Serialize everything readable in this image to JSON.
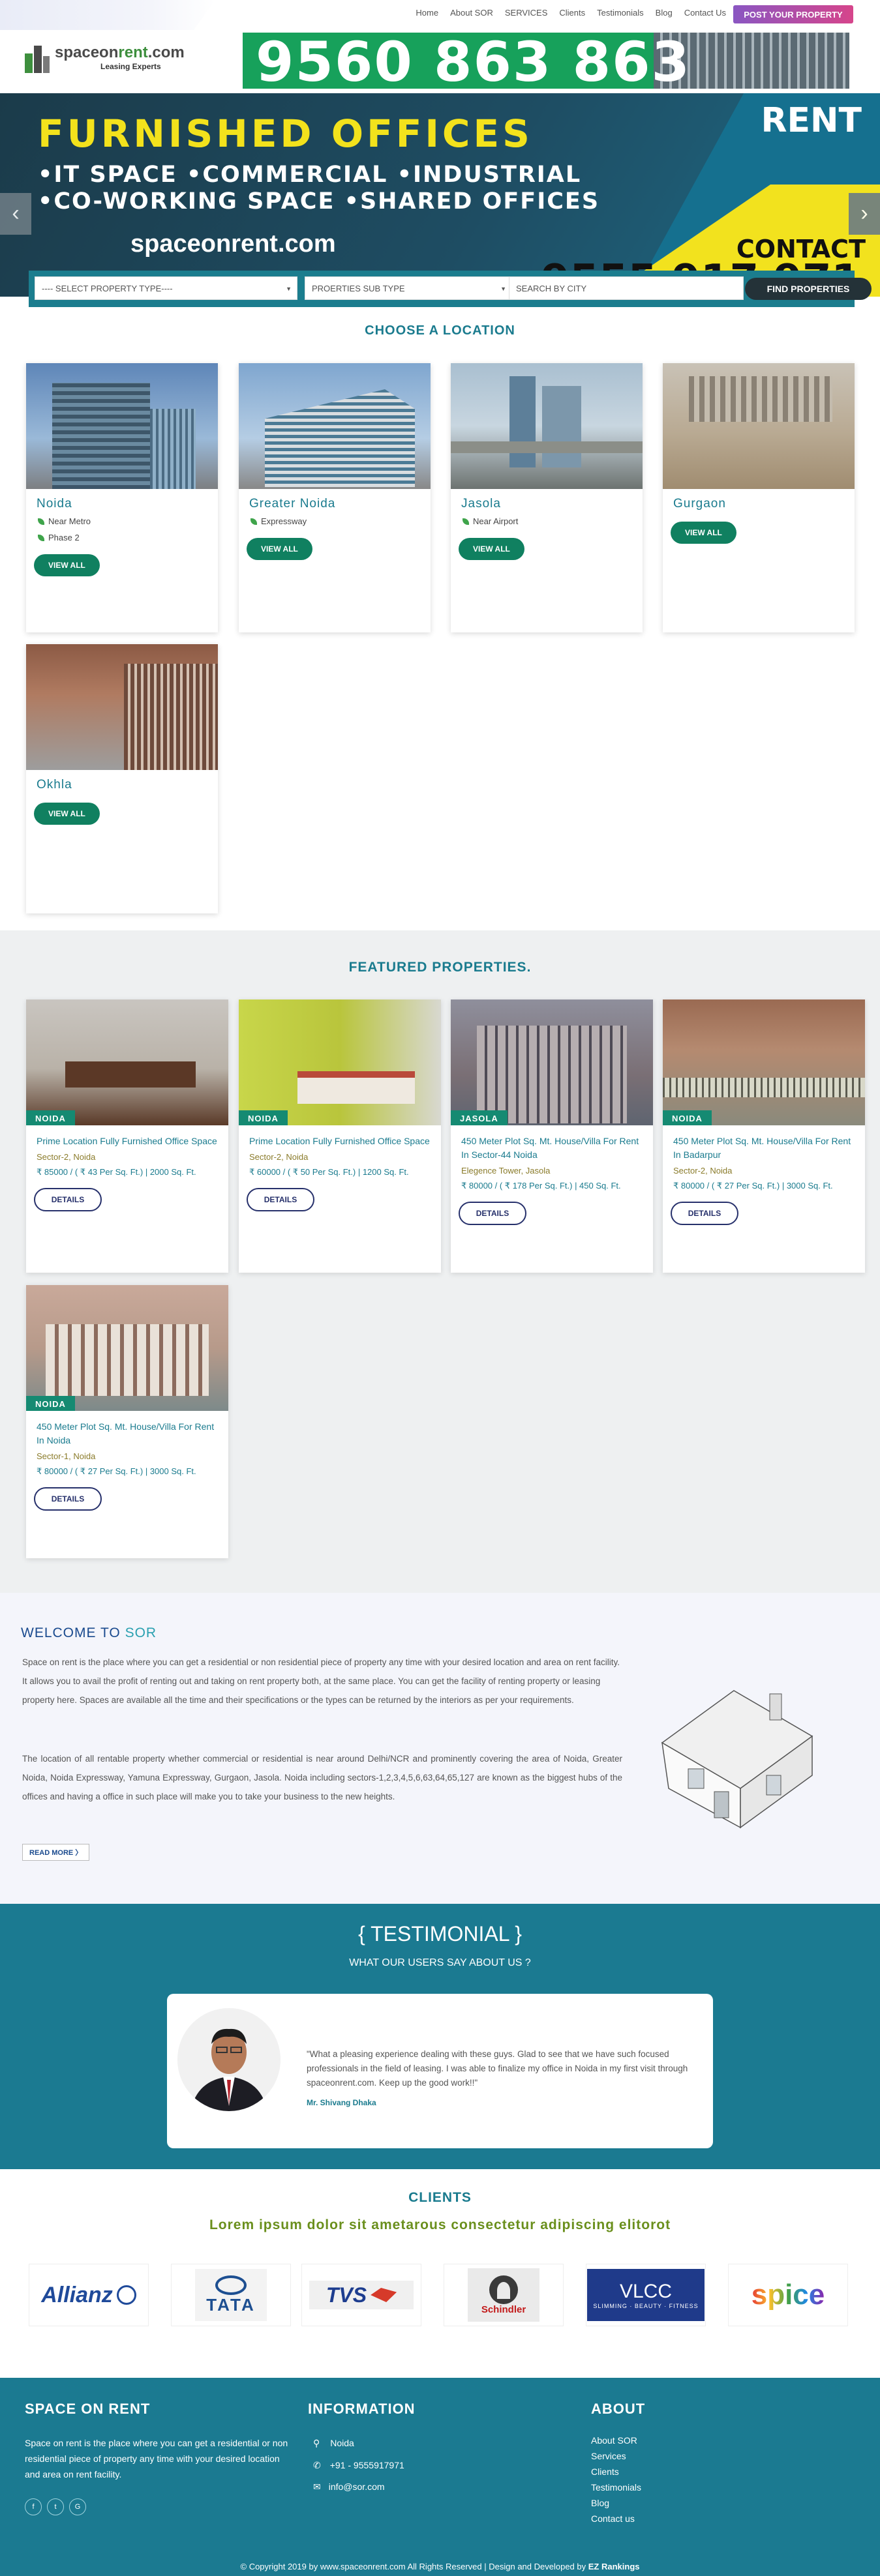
{
  "nav": {
    "items": [
      "Home",
      "About SOR",
      "SERVICES",
      "Clients",
      "Testimonials",
      "Blog",
      "Contact Us"
    ],
    "post_button": "POST YOUR PROPERTY"
  },
  "brand": {
    "name_part1": "spaceon",
    "name_part2": "rent",
    "name_part3": ".com",
    "tagline": "Leasing Experts"
  },
  "phone_banner": {
    "number": "9560 863 863"
  },
  "hero": {
    "headline": "FURNISHED OFFICES",
    "rent": "RENT",
    "line1": "•IT SPACE   •COMMERCIAL   •INDUSTRIAL",
    "line2": "•CO-WORKING SPACE   •SHARED OFFICES",
    "site": "spaceonrent.com",
    "contact": "CONTACT",
    "number": "9555 917 971"
  },
  "search": {
    "property_type": "---- SELECT PROPERTY TYPE----",
    "sub_type": "PROERTIES SUB TYPE",
    "city_placeholder": "SEARCH BY CITY",
    "button": "FIND PROPERTIES"
  },
  "locations_title": "CHOOSE A LOCATION",
  "locations": [
    {
      "name": "Noida",
      "tags": [
        "Near Metro",
        "Phase 2"
      ],
      "button": "VIEW ALL"
    },
    {
      "name": "Greater Noida",
      "tags": [
        "Expressway"
      ],
      "button": "VIEW ALL"
    },
    {
      "name": "Jasola",
      "tags": [
        "Near Airport"
      ],
      "button": "VIEW ALL"
    },
    {
      "name": "Gurgaon",
      "tags": [],
      "button": "VIEW ALL"
    },
    {
      "name": "Okhla",
      "tags": [],
      "button": "VIEW ALL"
    }
  ],
  "featured_title": "FEATURED PROPERTIES.",
  "properties": [
    {
      "badge": "NOIDA",
      "title": "Prime Location Fully Furnished Office Space",
      "sector": "Sector-2, Noida",
      "price": "₹ 85000 / ( ₹ 43 Per Sq. Ft.) | 2000 Sq. Ft.",
      "button": "DETAILS"
    },
    {
      "badge": "NOIDA",
      "title": "Prime Location Fully Furnished Office Space",
      "sector": "Sector-2, Noida",
      "price": "₹ 60000 / ( ₹ 50 Per Sq. Ft.) | 1200 Sq. Ft.",
      "button": "DETAILS"
    },
    {
      "badge": "JASOLA",
      "title": "450 Meter Plot Sq. Mt. House/Villa For Rent In Sector-44 Noida",
      "sector": "Elegence Tower, Jasola",
      "price": "₹ 80000 / ( ₹ 178 Per Sq. Ft.) | 450 Sq. Ft.",
      "button": "DETAILS"
    },
    {
      "badge": "NOIDA",
      "title": "450 Meter Plot Sq. Mt. House/Villa For Rent In Badarpur",
      "sector": "Sector-2, Noida",
      "price": "₹ 80000 / ( ₹ 27 Per Sq. Ft.) | 3000 Sq. Ft.",
      "button": "DETAILS"
    },
    {
      "badge": "NOIDA",
      "title": "450 Meter Plot Sq. Mt. House/Villa For Rent In Noida",
      "sector": "Sector-1, Noida",
      "price": "₹ 80000 / ( ₹ 27 Per Sq. Ft.) | 3000 Sq. Ft.",
      "button": "DETAILS"
    }
  ],
  "welcome": {
    "title_a": "WELCOME TO ",
    "title_b": "SOR",
    "p1": "Space on rent is the place where you can get a residential or non residential piece of property any time with your desired location and area on rent facility. It allows you to avail the profit of renting out and taking on rent property both, at the same place. You can get the facility of renting property or leasing property here. Spaces are available all the time and their specifications or the types can be returned by the interiors as per your requirements.",
    "p2": "The location of all rentable property whether commercial or residential is near around Delhi/NCR and prominently covering the area of Noida, Greater Noida, Noida Expressway, Yamuna Expressway, Gurgaon, Jasola. Noida including sectors-1,2,3,4,5,6,63,64,65,127 are known as the biggest hubs of the offices and having a office in such place will make you to take your business to the new heights.",
    "read_more": "READ MORE  〉"
  },
  "testimonial": {
    "title": "{ TESTIMONIAL }",
    "subtitle": "WHAT OUR USERS SAY ABOUT US ?",
    "quote": "\"What a pleasing experience dealing with these guys. Glad to see that we have such focused professionals in the field of leasing. I was able to finalize my office in Noida in my first visit through spaceonrent.com. Keep up the good work!!\"",
    "author": "Mr. Shivang Dhaka"
  },
  "clients": {
    "title": "CLIENTS",
    "subtitle": "Lorem ipsum dolor sit ametarous consectetur adipiscing elitorot",
    "logos": [
      "Allianz",
      "TATA",
      "TVS",
      "Schindler",
      "VLCC",
      "spice"
    ],
    "vlcc_tagline": "SLIMMING · BEAUTY · FITNESS"
  },
  "footer": {
    "col1_title": "SPACE ON RENT",
    "col1_text": "Space on rent is the place where you can get a residential or non residential piece of property any time with your desired location and area on rent facility.",
    "social": [
      "f",
      "t",
      "G"
    ],
    "col2_title": "INFORMATION",
    "address": "Noida",
    "phone": "+91 - 9555917971",
    "email": "info@sor.com",
    "col3_title": "ABOUT",
    "links": [
      "About SOR",
      "Services",
      "Clients",
      "Testimonials",
      "Blog",
      "Contact us"
    ]
  },
  "copyright": {
    "text": "© Copyright 2019 by www.spaceonrent.com All Rights Reserved | Design and Developed by ",
    "credit": "EZ Rankings"
  }
}
